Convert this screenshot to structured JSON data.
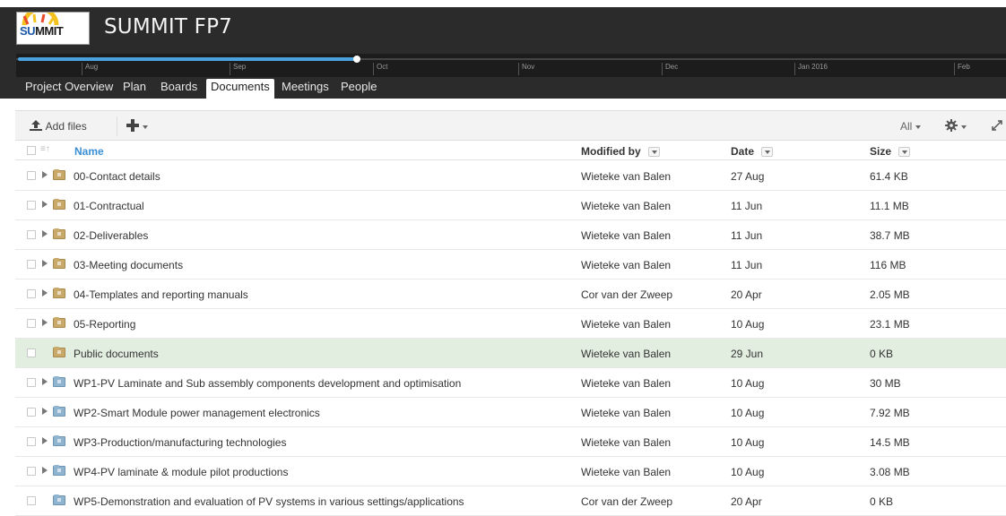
{
  "app": {
    "title": "SUMMIT FP7",
    "logo_su": "SU",
    "logo_mmit": "MMIT"
  },
  "timeline": {
    "months": [
      "Aug",
      "Sep",
      "Oct",
      "Nov",
      "Dec",
      "Jan 2016",
      "Feb"
    ]
  },
  "nav": {
    "tabs": [
      "Project Overview",
      "Plan",
      "Boards",
      "Documents",
      "Meetings",
      "People"
    ],
    "active": "Documents"
  },
  "toolbar": {
    "add_files_label": "Add files",
    "filter_label": "All"
  },
  "table": {
    "columns": {
      "name": "Name",
      "modified_by": "Modified by",
      "date": "Date",
      "size": "Size"
    },
    "rows": [
      {
        "name": "00-Contact details",
        "modified_by": "Wieteke van Balen",
        "date": "27 Aug",
        "size": "61.4 KB",
        "folder": "tan",
        "expandable": true
      },
      {
        "name": "01-Contractual",
        "modified_by": "Wieteke van Balen",
        "date": "11 Jun",
        "size": "11.1 MB",
        "folder": "tan",
        "expandable": true
      },
      {
        "name": "02-Deliverables",
        "modified_by": "Wieteke van Balen",
        "date": "11 Jun",
        "size": "38.7 MB",
        "folder": "tan",
        "expandable": true
      },
      {
        "name": "03-Meeting documents",
        "modified_by": "Wieteke van Balen",
        "date": "11 Jun",
        "size": "116 MB",
        "folder": "tan",
        "expandable": true
      },
      {
        "name": "04-Templates and reporting manuals",
        "modified_by": "Cor van der Zweep",
        "date": "20 Apr",
        "size": "2.05 MB",
        "folder": "tan",
        "expandable": true
      },
      {
        "name": "05-Reporting",
        "modified_by": "Wieteke van Balen",
        "date": "10 Aug",
        "size": "23.1 MB",
        "folder": "tan",
        "expandable": true
      },
      {
        "name": "Public documents",
        "modified_by": "Wieteke van Balen",
        "date": "29 Jun",
        "size": "0 KB",
        "folder": "tan",
        "expandable": false
      },
      {
        "name": "WP1-PV Laminate and Sub assembly components development and optimisation",
        "modified_by": "Wieteke van Balen",
        "date": "10 Aug",
        "size": "30 MB",
        "folder": "blue",
        "expandable": true
      },
      {
        "name": "WP2-Smart Module power management electronics",
        "modified_by": "Wieteke van Balen",
        "date": "10 Aug",
        "size": "7.92 MB",
        "folder": "blue",
        "expandable": true
      },
      {
        "name": "WP3-Production/manufacturing technologies",
        "modified_by": "Wieteke van Balen",
        "date": "10 Aug",
        "size": "14.5 MB",
        "folder": "blue",
        "expandable": true
      },
      {
        "name": "WP4-PV laminate & module pilot productions",
        "modified_by": "Wieteke van Balen",
        "date": "10 Aug",
        "size": "3.08 MB",
        "folder": "blue",
        "expandable": true
      },
      {
        "name": "WP5-Demonstration and evaluation of PV systems in various settings/applications",
        "modified_by": "Cor van der Zweep",
        "date": "20 Apr",
        "size": "0 KB",
        "folder": "blue",
        "expandable": false
      }
    ]
  },
  "colors": {
    "header_bg": "#2b2b2b",
    "accent": "#3a8fd6",
    "highlight_row": "#e2efe0"
  }
}
